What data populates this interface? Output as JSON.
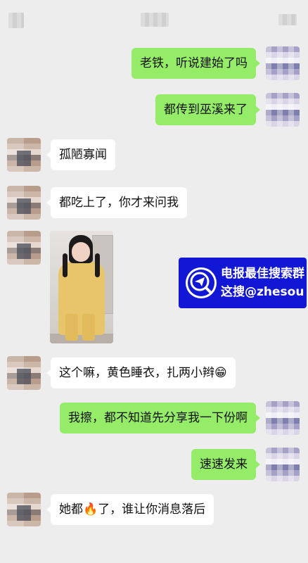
{
  "chat": {
    "messages": [
      {
        "from": "me",
        "text": "老铁，听说建始了吗"
      },
      {
        "from": "me",
        "text": "都传到巫溪来了"
      },
      {
        "from": "other",
        "text": "孤陋寡闻"
      },
      {
        "from": "other",
        "text": "都吃上了，你才来问我"
      },
      {
        "from": "other",
        "type": "image"
      },
      {
        "from": "other",
        "text": "这个嘛，黄色睡衣，扎两小辫😁"
      },
      {
        "from": "me",
        "text": "我擦，都不知道先分享我一下份啊"
      },
      {
        "from": "me",
        "text": "速速发来"
      },
      {
        "from": "other",
        "text": "她都🔥了，谁让你消息落后"
      }
    ]
  },
  "watermark": {
    "line1": "电报最佳搜索群",
    "line2": "这搜@zhesou",
    "icon": "telegram-search-icon"
  },
  "colors": {
    "background": "#ededed",
    "my_bubble": "#95ec69",
    "other_bubble": "#ffffff",
    "watermark_bg": "#1217d6"
  }
}
